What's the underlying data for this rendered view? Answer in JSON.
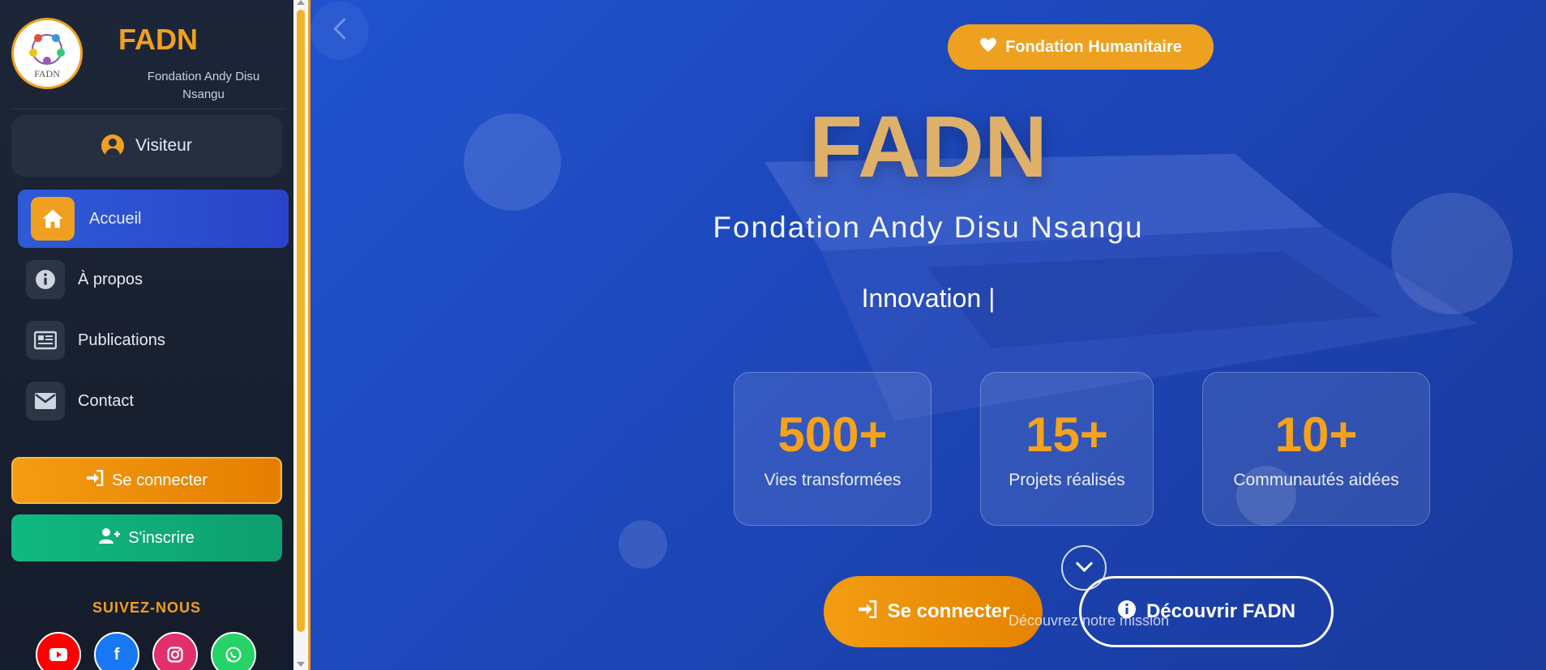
{
  "sidebar": {
    "brand": {
      "name": "FADN",
      "subtitle": "Fondation Andy Disu Nsangu",
      "logo_text": "FADN"
    },
    "user": {
      "label": "Visiteur"
    },
    "nav": [
      {
        "label": "Accueil",
        "icon": "home-icon",
        "active": true
      },
      {
        "label": "À propos",
        "icon": "info-icon",
        "active": false
      },
      {
        "label": "Publications",
        "icon": "newspaper-icon",
        "active": false
      },
      {
        "label": "Contact",
        "icon": "envelope-icon",
        "active": false
      }
    ],
    "login_label": "Se connecter",
    "signup_label": "S'inscrire",
    "follow_title": "SUIVEZ-NOUS",
    "socials": [
      {
        "name": "youtube",
        "color": "#ff0000"
      },
      {
        "name": "facebook",
        "color": "#1877f2"
      },
      {
        "name": "instagram",
        "color": "#e1306c"
      },
      {
        "name": "whatsapp",
        "color": "#25d366"
      }
    ]
  },
  "hero": {
    "badge": "Fondation Humanitaire",
    "title": "FADN",
    "subtitle": "Fondation Andy Disu Nsangu",
    "typed_text": "Innovation |",
    "stats": [
      {
        "value": "500+",
        "label": "Vies transformées"
      },
      {
        "value": "15+",
        "label": "Projets réalisés"
      },
      {
        "value": "10+",
        "label": "Communautés aidées"
      }
    ],
    "cta_login": "Se connecter",
    "cta_discover": "Découvrir FADN",
    "scroll_hint": "Découvrez notre mission"
  },
  "colors": {
    "accent": "#f0a020",
    "primary": "#2153d0",
    "success": "#10b981"
  }
}
